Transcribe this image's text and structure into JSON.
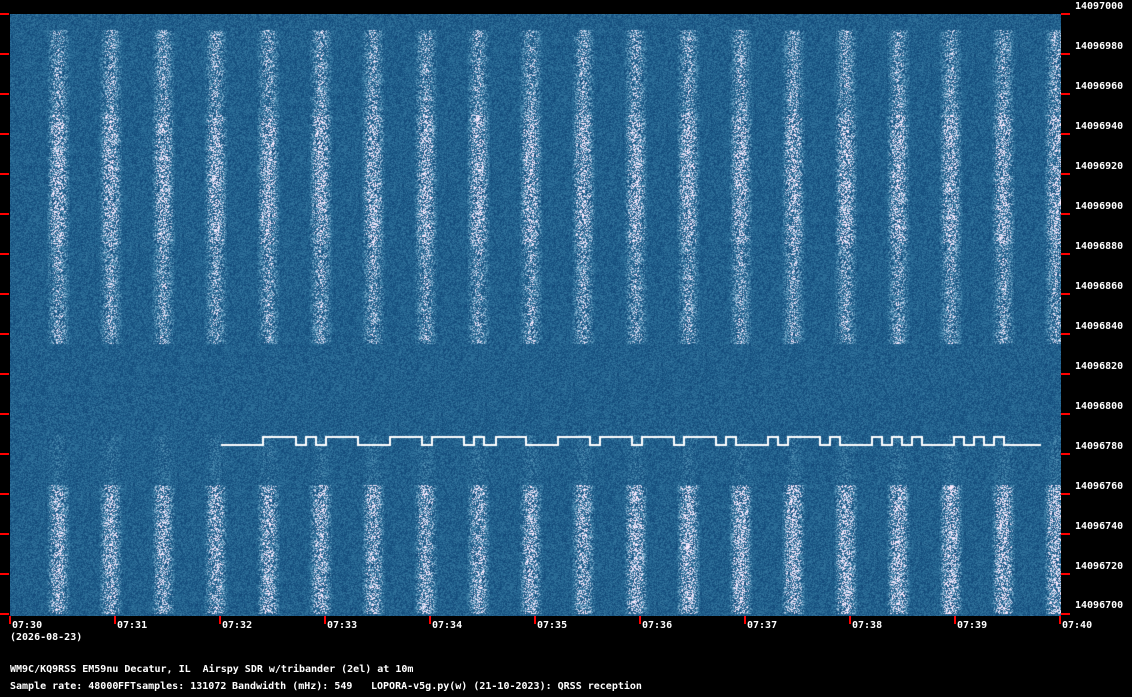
{
  "y_axis_labels": [
    "14097000",
    "14096980",
    "14096960",
    "14096940",
    "14096920",
    "14096900",
    "14096880",
    "14096860",
    "14096840",
    "14096820",
    "14096800",
    "14096780",
    "14096760",
    "14096740",
    "14096720",
    "14096700"
  ],
  "x_axis_labels": [
    "07:30",
    "07:31",
    "07:32",
    "07:33",
    "07:34",
    "07:35",
    "07:36",
    "07:37",
    "07:38",
    "07:39",
    "07:40"
  ],
  "date_label": "(2026-08-23)",
  "station_info": "WM9C/KQ9RSS EM59nu Decatur, IL  Airspy SDR w/tribander (2el) at 10m",
  "sample_rate": "Sample rate: 48000",
  "fft_samples": "FFTsamples: 131072",
  "bandwidth": "Bandwidth (mHz): 549",
  "software": "LOPORA-v5g.py(w) (21-10-2023): QRSS reception",
  "colors": {
    "background": "#000000",
    "waterfall_base": "#0a2a5c",
    "tick": "#ff0000",
    "text": "#ffffff"
  }
}
